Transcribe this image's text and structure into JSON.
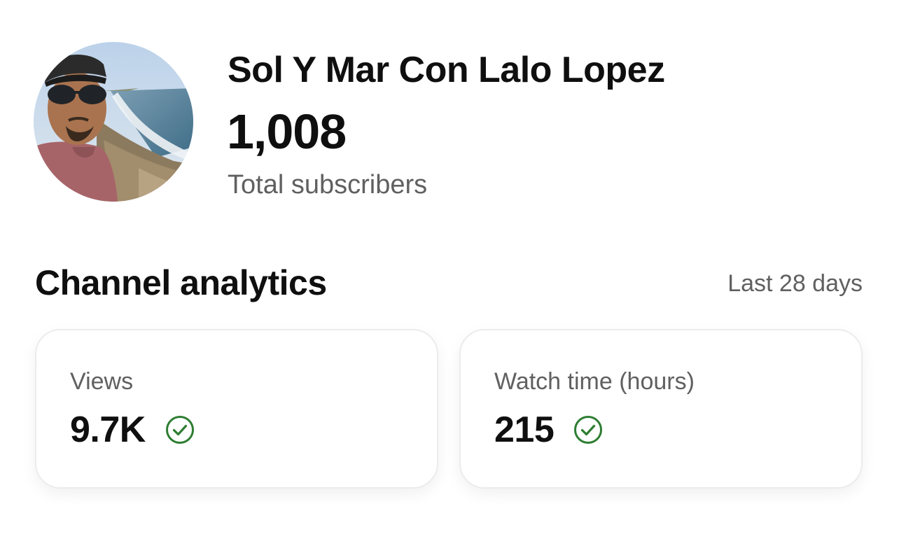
{
  "channel": {
    "name": "Sol Y Mar Con Lalo Lopez",
    "subscriber_count": "1,008",
    "subscriber_label": "Total subscribers",
    "avatar_icon": "channel-avatar-photo"
  },
  "analytics": {
    "title": "Channel analytics",
    "period": "Last 28 days",
    "cards": [
      {
        "label": "Views",
        "value": "9.7K",
        "status_icon": "check-circle-icon"
      },
      {
        "label": "Watch time (hours)",
        "value": "215",
        "status_icon": "check-circle-icon"
      }
    ]
  },
  "colors": {
    "primary_text": "#0f0f0f",
    "secondary_text": "#606060",
    "check_green": "#2e7d32",
    "card_border": "#ececec"
  }
}
